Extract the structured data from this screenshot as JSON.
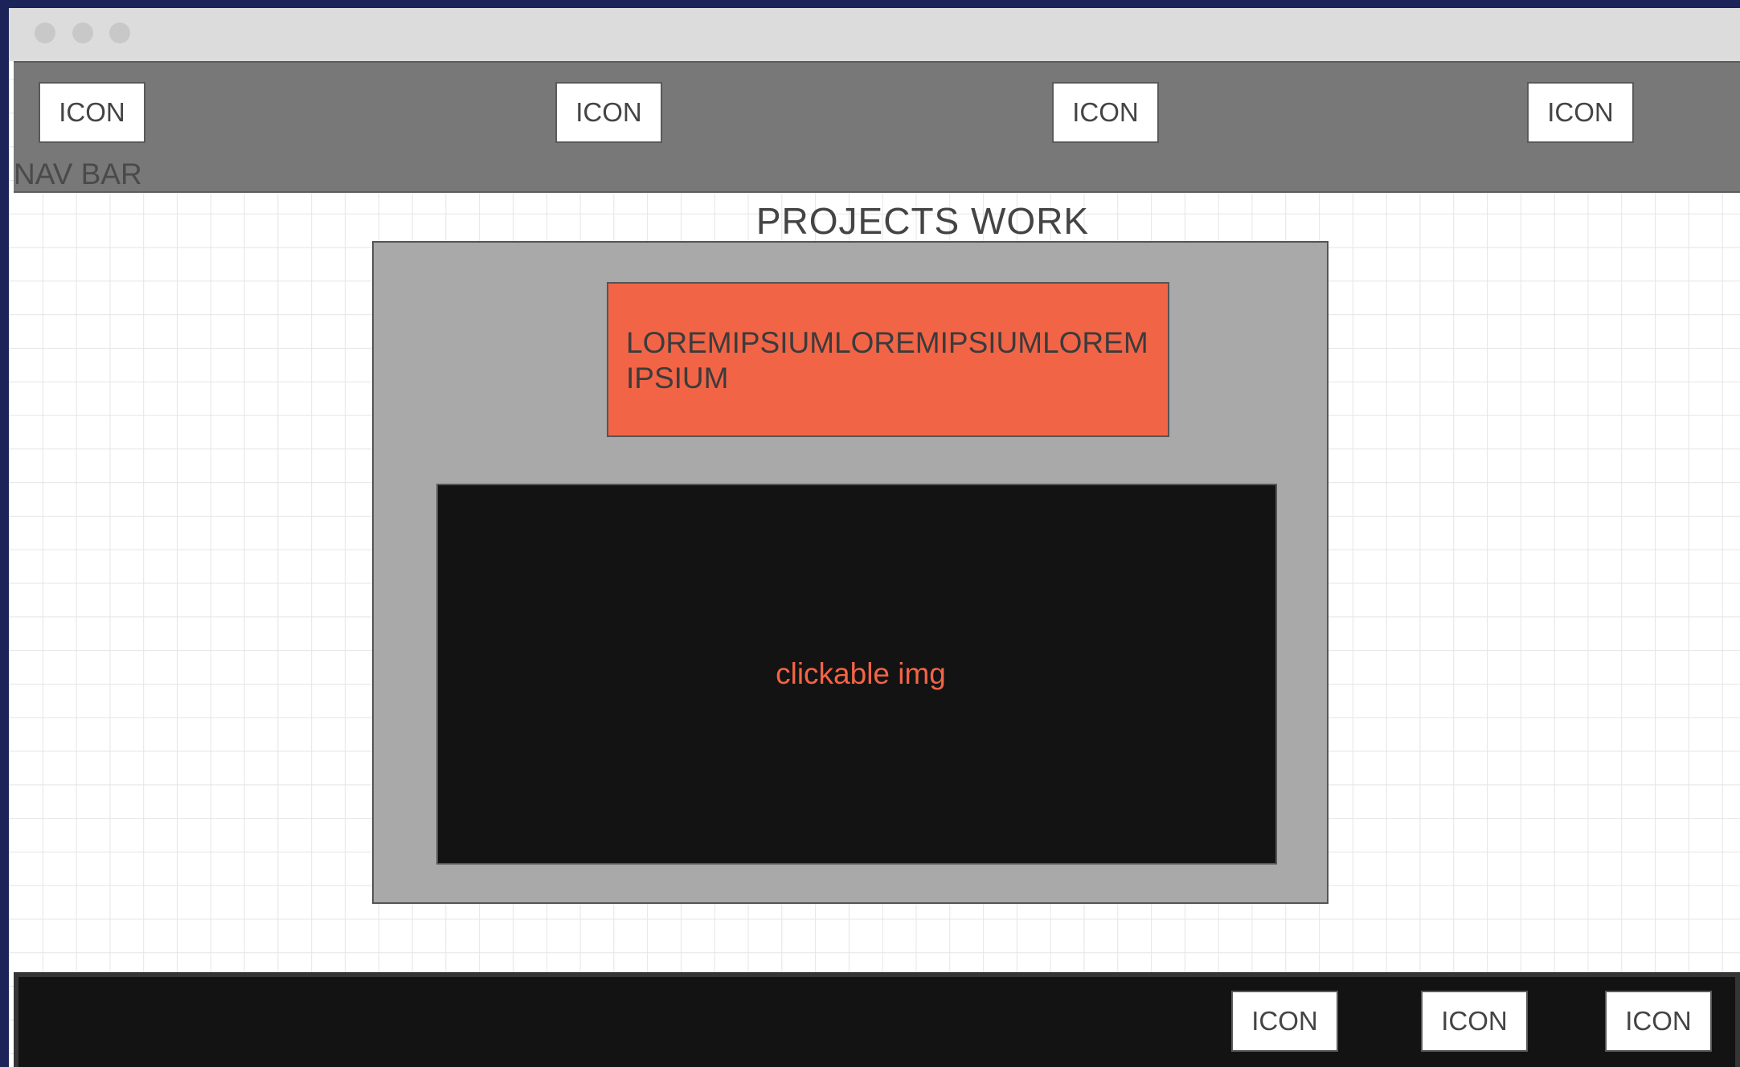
{
  "navbar": {
    "label": "NAV BAR",
    "icons": [
      "ICON",
      "ICON",
      "ICON",
      "ICON"
    ]
  },
  "main": {
    "title": "PROJECTS WORK",
    "card": {
      "text": "LOREMIPSIUMLOREMIPSIUMLOREMIPSIUM",
      "image_label": "clickable img"
    }
  },
  "footer": {
    "icons": [
      "ICON",
      "ICON",
      "ICON"
    ]
  },
  "colors": {
    "accent": "#f26446",
    "navbar": "#787878",
    "footer": "#131313",
    "card": "#a9a9a9"
  }
}
